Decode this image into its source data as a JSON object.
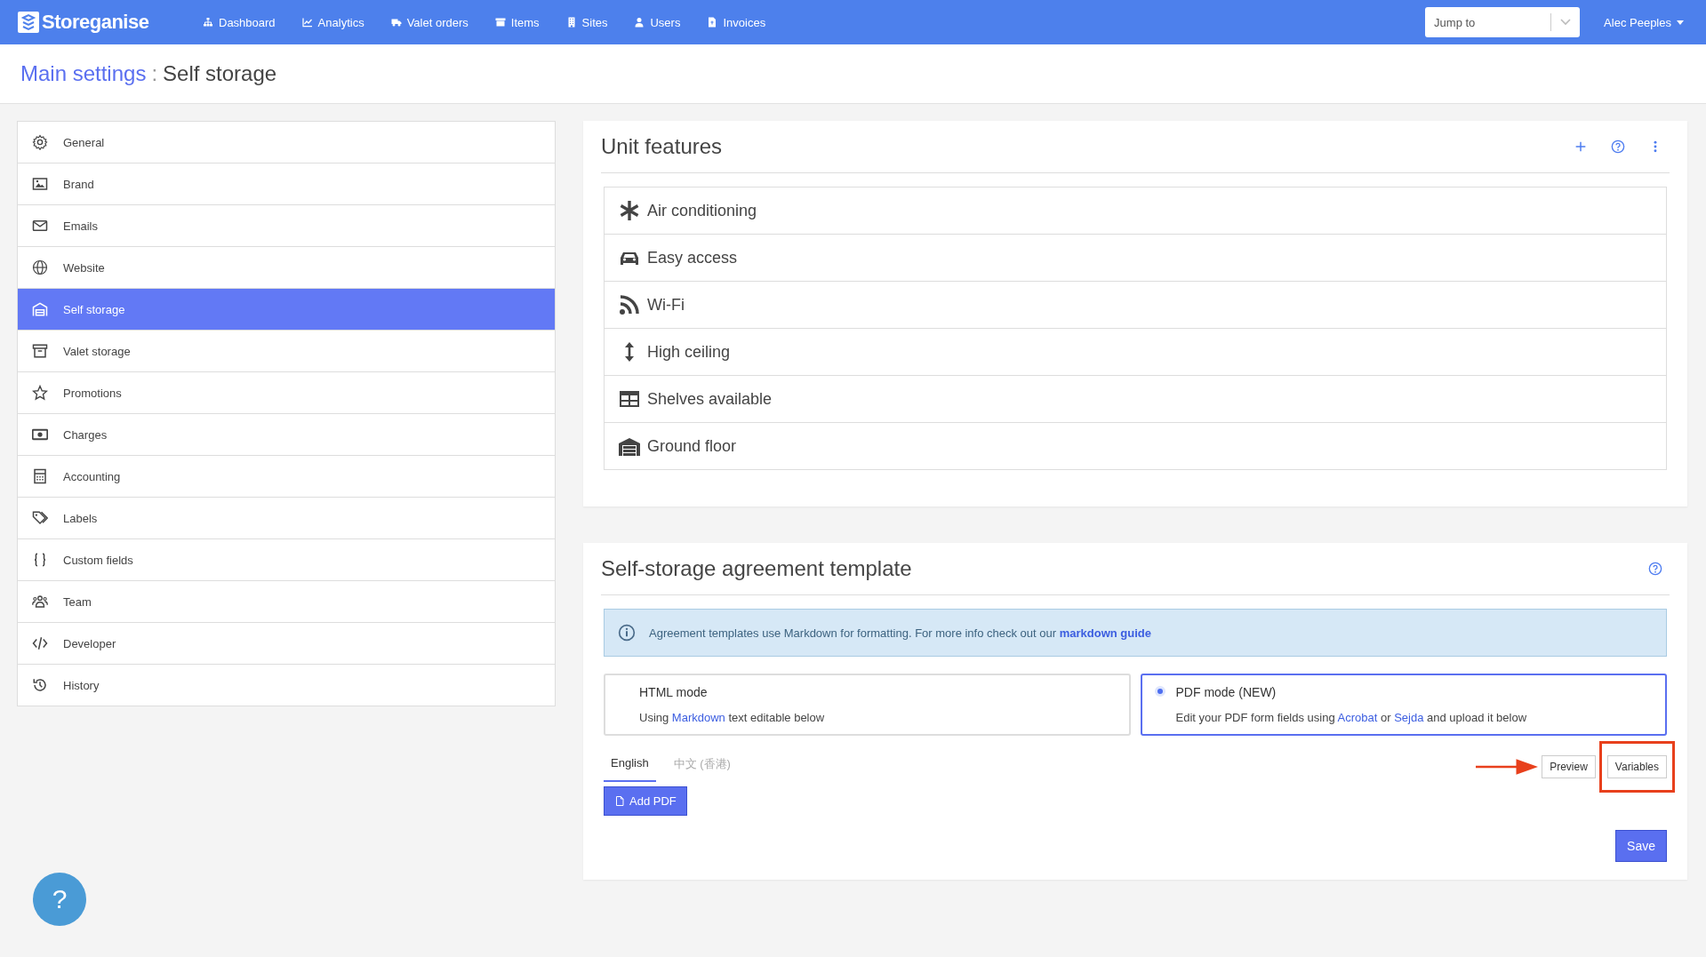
{
  "nav": {
    "logo": "Storeganise",
    "items": [
      {
        "label": "Dashboard"
      },
      {
        "label": "Analytics"
      },
      {
        "label": "Valet orders"
      },
      {
        "label": "Items"
      },
      {
        "label": "Sites"
      },
      {
        "label": "Users"
      },
      {
        "label": "Invoices"
      }
    ],
    "jump_to": {
      "placeholder": "Jump to"
    },
    "user": "Alec Peeples"
  },
  "breadcrumb": {
    "parent": "Main settings",
    "separator": ":",
    "current": "Self storage"
  },
  "sidebar": {
    "items": [
      {
        "label": "General",
        "selected": false
      },
      {
        "label": "Brand",
        "selected": false
      },
      {
        "label": "Emails",
        "selected": false
      },
      {
        "label": "Website",
        "selected": false
      },
      {
        "label": "Self storage",
        "selected": true
      },
      {
        "label": "Valet storage",
        "selected": false
      },
      {
        "label": "Promotions",
        "selected": false
      },
      {
        "label": "Charges",
        "selected": false
      },
      {
        "label": "Accounting",
        "selected": false
      },
      {
        "label": "Labels",
        "selected": false
      },
      {
        "label": "Custom fields",
        "selected": false
      },
      {
        "label": "Team",
        "selected": false
      },
      {
        "label": "Developer",
        "selected": false
      },
      {
        "label": "History",
        "selected": false
      }
    ]
  },
  "unit_features": {
    "title": "Unit features",
    "items": [
      {
        "label": "Air conditioning"
      },
      {
        "label": "Easy access"
      },
      {
        "label": "Wi-Fi"
      },
      {
        "label": "High ceiling"
      },
      {
        "label": "Shelves available"
      },
      {
        "label": "Ground floor"
      }
    ]
  },
  "agreement": {
    "title": "Self-storage agreement template",
    "info": {
      "text": "Agreement templates use Markdown for formatting. For more info check out our",
      "link": "markdown guide"
    },
    "modes": [
      {
        "title": "HTML mode",
        "selected": false,
        "description": [
          {
            "text": "Using "
          },
          {
            "link": "Markdown"
          },
          {
            "text": " text editable below"
          }
        ]
      },
      {
        "title": "PDF mode (NEW)",
        "selected": true,
        "description": [
          {
            "text": "Edit your PDF form fields using "
          },
          {
            "link": "Acrobat"
          },
          {
            "text": " or "
          },
          {
            "link": "Sejda"
          },
          {
            "text": " and upload it below"
          }
        ]
      }
    ],
    "tabs": [
      {
        "label": "English",
        "selected": true
      },
      {
        "label": "中文 (香港)",
        "selected": false
      }
    ],
    "preview_button": "Preview",
    "variables_button": "Variables",
    "add_pdf_button": "Add PDF",
    "save_button": "Save"
  },
  "help_button": "?"
}
